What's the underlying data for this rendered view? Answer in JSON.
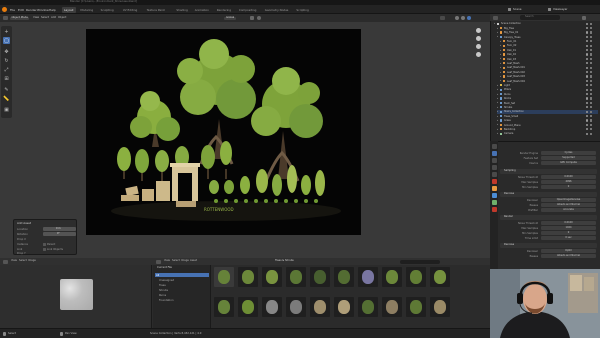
{
  "window_title": "Blender [C:\\Users\\...\\Environment_Showcase.blend]",
  "menu": [
    "File",
    "Edit",
    "Render",
    "Window",
    "Help"
  ],
  "workspaces": [
    {
      "label": "Layout",
      "active": true
    },
    {
      "label": "Modeling",
      "active": false
    },
    {
      "label": "Sculpting",
      "active": false
    },
    {
      "label": "UV Editing",
      "active": false
    },
    {
      "label": "Texture Paint",
      "active": false
    },
    {
      "label": "Shading",
      "active": false
    },
    {
      "label": "Animation",
      "active": false
    },
    {
      "label": "Rendering",
      "active": false
    },
    {
      "label": "Compositing",
      "active": false
    },
    {
      "label": "Geometry Nodes",
      "active": false
    },
    {
      "label": "Scripting",
      "active": false
    }
  ],
  "scene": {
    "name": "Scene",
    "view_layer": "ViewLayer"
  },
  "viewport": {
    "mode": "Object Mode",
    "menus": [
      "View",
      "Select",
      "Add",
      "Object"
    ],
    "transform": "Global",
    "render_caption": "ROTTENWOOD"
  },
  "operator_panel": {
    "title": "Add Asset",
    "rows": [
      {
        "label": "Location",
        "value": "0 m"
      },
      {
        "label": "Rotation",
        "value": "0°"
      },
      {
        "label": "Drop X",
        "value": ""
      },
      {
        "label": "Instance",
        "value": "Parent"
      },
      {
        "label": "Link",
        "value": "Link Objects"
      },
      {
        "label": "Drop Y",
        "value": ""
      }
    ]
  },
  "asset_browser": {
    "header_menus": [
      "View",
      "Select",
      "Image",
      "Asset"
    ],
    "library": "Current File",
    "editor_menus": [
      "View",
      "Select",
      "Image"
    ],
    "catalog_header": "Trees & Shrubs",
    "catalogs": [
      "All",
      "Unassigned",
      "Trees",
      "Shrubs",
      "Ruins",
      "Foundation"
    ],
    "assets": [
      {
        "name": "Tree_A"
      },
      {
        "name": "Tree_B"
      },
      {
        "name": "Tree_C"
      },
      {
        "name": "Tree_D"
      },
      {
        "name": "Bush_A"
      },
      {
        "name": "Bush_B"
      },
      {
        "name": "Pillar"
      },
      {
        "name": "Tree_E"
      },
      {
        "name": "Tree_F"
      },
      {
        "name": "Tree_G"
      },
      {
        "name": "Tree_H"
      },
      {
        "name": "Oak_Tall"
      },
      {
        "name": "Rock_A"
      },
      {
        "name": "Rock_B"
      },
      {
        "name": "Arch"
      },
      {
        "name": "Column"
      },
      {
        "name": "Shrub_A"
      },
      {
        "name": "Wall"
      },
      {
        "name": "Shrub_B"
      },
      {
        "name": "Stairs"
      }
    ]
  },
  "statusbar": {
    "left": "Select",
    "mid": "Pan View",
    "right": "Scene Collection | Verts 8,432,121 | 4.0"
  },
  "outliner": {
    "search_placeholder": "Search",
    "rows": [
      {
        "label": "Scene Collection",
        "icon": "collection-icon",
        "indent": 0,
        "color": "#d6d6d6"
      },
      {
        "label": "Big_Tree",
        "icon": "object-icon",
        "indent": 1,
        "color": "#e89a41"
      },
      {
        "label": "Big_Tree_01",
        "icon": "object-icon",
        "indent": 1,
        "color": "#e89a41"
      },
      {
        "label": "Canopy_Trees",
        "icon": "collection-icon",
        "indent": 1,
        "color": "#6ea0d6"
      },
      {
        "label": "Fern_01",
        "icon": "object-icon",
        "indent": 2,
        "color": "#e89a41"
      },
      {
        "label": "Fern_02",
        "icon": "object-icon",
        "indent": 2,
        "color": "#e89a41"
      },
      {
        "label": "Oak_01",
        "icon": "object-icon",
        "indent": 2,
        "color": "#e89a41"
      },
      {
        "label": "Oak_02",
        "icon": "object-icon",
        "indent": 2,
        "color": "#e89a41"
      },
      {
        "label": "Oak_03",
        "icon": "object-icon",
        "indent": 2,
        "color": "#e89a41"
      },
      {
        "label": "Leaf_Mesh",
        "icon": "object-icon",
        "indent": 2,
        "color": "#e89a41"
      },
      {
        "label": "Leaf_Mesh.001",
        "icon": "object-icon",
        "indent": 2,
        "color": "#e89a41"
      },
      {
        "label": "Leaf_Mesh.002",
        "icon": "object-icon",
        "indent": 2,
        "color": "#e89a41"
      },
      {
        "label": "Leaf_Mesh.003",
        "icon": "object-icon",
        "indent": 2,
        "color": "#e89a41"
      },
      {
        "label": "Leaf_Mesh.004",
        "icon": "object-icon",
        "indent": 2,
        "color": "#e89a41"
      },
      {
        "label": "Light",
        "icon": "light-icon",
        "indent": 1,
        "color": "#e8c44a"
      },
      {
        "label": "Pillars",
        "icon": "collection-icon",
        "indent": 1,
        "color": "#6ea0d6"
      },
      {
        "label": "Ruins",
        "icon": "collection-icon",
        "indent": 1,
        "color": "#6ea0d6"
      },
      {
        "label": "Rocks",
        "icon": "collection-icon",
        "indent": 1,
        "color": "#6ea0d6"
      },
      {
        "label": "Bush_Set",
        "icon": "collection-icon",
        "indent": 1,
        "color": "#6ea0d6"
      },
      {
        "label": "Shrubs",
        "icon": "collection-icon",
        "indent": 1,
        "color": "#6ea0d6"
      },
      {
        "label": "Stairs_Collection",
        "icon": "collection-icon",
        "indent": 1,
        "color": "#6ea0d6",
        "selected": true
      },
      {
        "label": "Trees_Small",
        "icon": "collection-icon",
        "indent": 1,
        "color": "#6ea0d6"
      },
      {
        "label": "Grass",
        "icon": "collection-icon",
        "indent": 1,
        "color": "#6ea0d6"
      },
      {
        "label": "Ground_Plane",
        "icon": "object-icon",
        "indent": 1,
        "color": "#e89a41"
      },
      {
        "label": "Backdrop",
        "icon": "object-icon",
        "indent": 1,
        "color": "#e89a41"
      },
      {
        "label": "Camera",
        "icon": "camera-icon",
        "indent": 1,
        "color": "#9ad0a0"
      }
    ]
  },
  "properties": {
    "rows_top": [
      {
        "label": "Render Engine",
        "value": "Cycles"
      },
      {
        "label": "Feature Set",
        "value": "Supported"
      },
      {
        "label": "Device",
        "value": "GPU Compute"
      }
    ],
    "sections": [
      {
        "title": "Sampling",
        "rows": [
          {
            "label": "Noise Threshold",
            "value": "0.0100"
          },
          {
            "label": "Max Samples",
            "value": "4096"
          },
          {
            "label": "Min Samples",
            "value": "0"
          }
        ]
      },
      {
        "title": "Denoise",
        "rows": [
          {
            "label": "Denoiser",
            "value": "OpenImageDenoise"
          },
          {
            "label": "Passes",
            "value": "Albedo and Normal"
          },
          {
            "label": "Prefilter",
            "value": "Accurate"
          }
        ]
      },
      {
        "title": "Render",
        "rows": [
          {
            "label": "Noise Threshold",
            "value": "0.0100"
          },
          {
            "label": "Max Samples",
            "value": "1024"
          },
          {
            "label": "Min Samples",
            "value": "0"
          },
          {
            "label": "Time Limit",
            "value": "0 sec"
          }
        ]
      },
      {
        "title": "Denoise",
        "rows": [
          {
            "label": "Denoiser",
            "value": "OptiX"
          },
          {
            "label": "Passes",
            "value": "Albedo and Normal"
          }
        ]
      }
    ]
  },
  "colors": {
    "accent": "#4772b3",
    "panel": "#2a2a2a",
    "render_bg": "#050505",
    "foliage": "#7da23a"
  }
}
